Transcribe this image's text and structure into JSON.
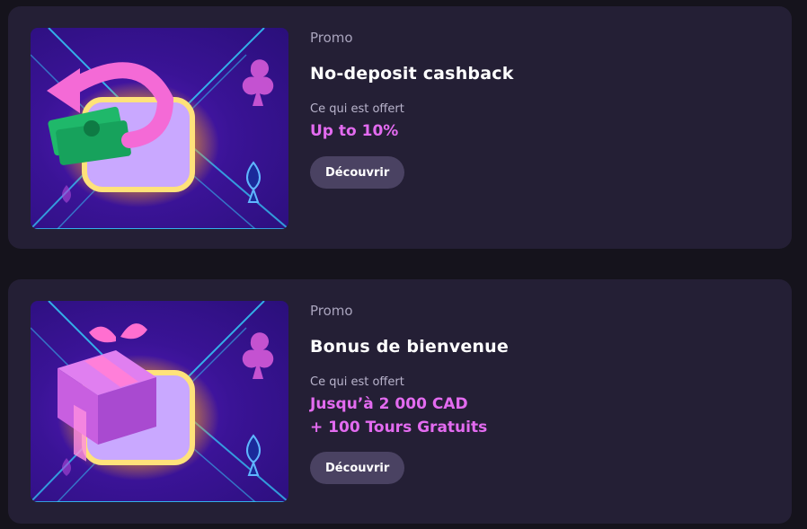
{
  "promos": [
    {
      "label": "Promo",
      "title": "No-deposit cashback",
      "offer_label": "Ce qui est offert",
      "offer_lines": [
        "Up to 10%"
      ],
      "button": "Découvrir",
      "illustration": "cashback-arrow-money-icon"
    },
    {
      "label": "Promo",
      "title": "Bonus de bienvenue",
      "offer_label": "Ce qui est offert",
      "offer_lines": [
        "Jusqu’à 2 000 CAD",
        "+ 100 Tours Gratuits"
      ],
      "button": "Découvrir",
      "illustration": "gift-box-icon"
    }
  ],
  "colors": {
    "page_bg": "#15131c",
    "card_bg": "#241f35",
    "accent": "#e36bf0",
    "button_bg": "#4a4262"
  }
}
